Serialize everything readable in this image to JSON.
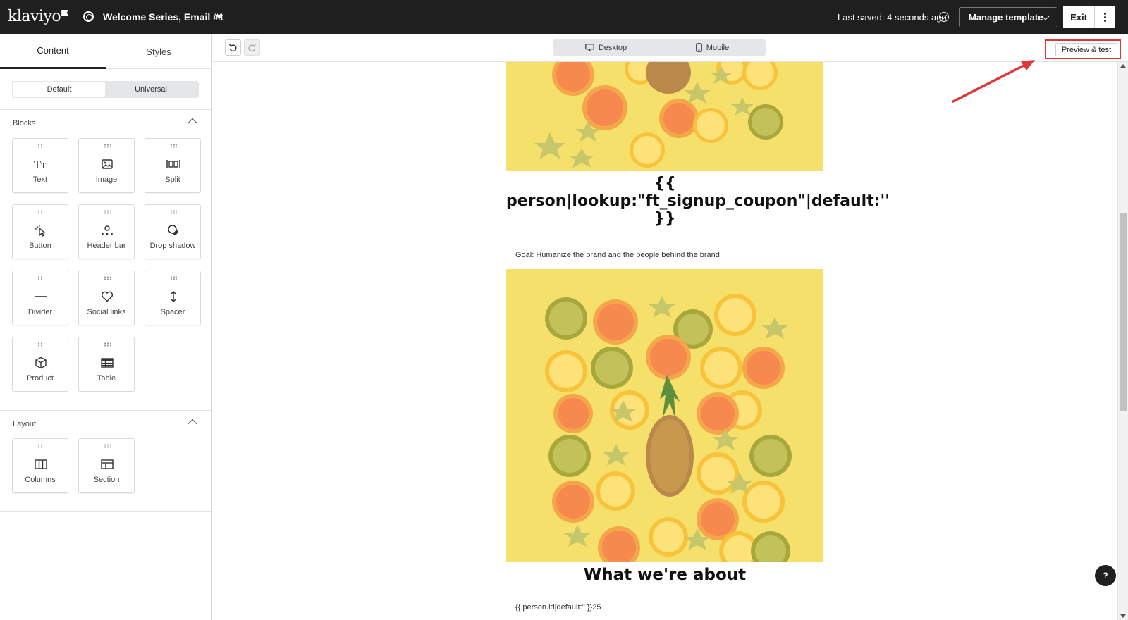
{
  "header": {
    "logo_text": "klaviyo",
    "email_title": "Welcome Series, Email #1",
    "last_saved": "Last saved: 4 seconds ago",
    "manage_template_label": "Manage template",
    "exit_label": "Exit"
  },
  "sidebar": {
    "tabs": [
      {
        "label": "Content"
      },
      {
        "label": "Styles"
      }
    ],
    "mode_toggle": [
      {
        "label": "Default"
      },
      {
        "label": "Universal"
      }
    ],
    "blocks_title": "Blocks",
    "blocks": [
      {
        "label": "Text",
        "icon": "text-icon"
      },
      {
        "label": "Image",
        "icon": "image-icon"
      },
      {
        "label": "Split",
        "icon": "split-icon"
      },
      {
        "label": "Button",
        "icon": "button-icon"
      },
      {
        "label": "Header bar",
        "icon": "header-bar-icon"
      },
      {
        "label": "Drop shadow",
        "icon": "drop-shadow-icon"
      },
      {
        "label": "Divider",
        "icon": "divider-icon"
      },
      {
        "label": "Social links",
        "icon": "heart-icon"
      },
      {
        "label": "Spacer",
        "icon": "spacer-icon"
      },
      {
        "label": "Product",
        "icon": "product-icon"
      },
      {
        "label": "Table",
        "icon": "table-icon"
      }
    ],
    "layout_title": "Layout",
    "layout_blocks": [
      {
        "label": "Columns",
        "icon": "columns-icon"
      },
      {
        "label": "Section",
        "icon": "section-icon"
      }
    ]
  },
  "toolbar": {
    "devices": [
      {
        "label": "Desktop",
        "icon": "desktop-icon"
      },
      {
        "label": "Mobile",
        "icon": "mobile-icon"
      }
    ],
    "preview_label": "Preview & test"
  },
  "email": {
    "coupon_heading": "{{ person|lookup:\"ft_signup_coupon\"|default:'' }}",
    "goal_text": "Goal: Humanize the brand and the people behind the brand",
    "about_heading": "What we're about",
    "person_id_text": "{{ person.id|default:'' }}25"
  },
  "help_label": "?",
  "colors": {
    "topbar": "#1f1f1f",
    "highlight": "#e0363a",
    "email_image_bg": "#f5e06c"
  }
}
